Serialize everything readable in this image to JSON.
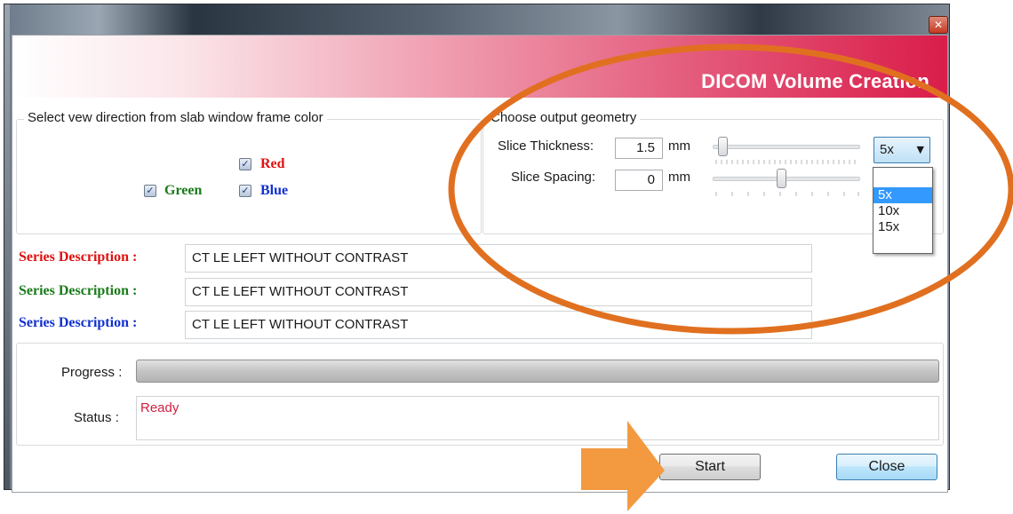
{
  "window": {
    "close_glyph": "✕",
    "header_title": "DICOM Volume Creation"
  },
  "view_direction": {
    "legend": "Select vew direction from slab window frame color",
    "checkboxes": [
      {
        "label": "Red",
        "checked": true,
        "color": "#e01010"
      },
      {
        "label": "Green",
        "checked": true,
        "color": "#1a7a1a"
      },
      {
        "label": "Blue",
        "checked": true,
        "color": "#1030d0"
      }
    ],
    "check_glyph": "✓"
  },
  "geometry": {
    "legend": "Choose output geometry",
    "slice_thickness": {
      "label": "Slice Thickness:",
      "value": "1.5",
      "unit": "mm"
    },
    "slice_spacing": {
      "label": "Slice Spacing:",
      "value": "0",
      "unit": "mm"
    },
    "multiplier": {
      "selected": "5x",
      "arrow": "▼",
      "options": [
        "",
        "5x",
        "10x",
        "15x"
      ],
      "highlighted": "5x"
    }
  },
  "series": [
    {
      "label": "Series Description :",
      "value": "CT LE LEFT WITHOUT CONTRAST",
      "color": "#e01010"
    },
    {
      "label": "Series Description :",
      "value": "CT LE LEFT WITHOUT CONTRAST",
      "color": "#1a7a1a"
    },
    {
      "label": "Series Description :",
      "value": "CT LE LEFT WITHOUT CONTRAST",
      "color": "#1030d0"
    }
  ],
  "progress": {
    "label": "Progress :",
    "fraction": 0
  },
  "status": {
    "label": "Status :",
    "text": "Ready"
  },
  "buttons": {
    "start": "Start",
    "close": "Close"
  },
  "annotations": {
    "ellipse_color": "#e07020",
    "arrow_color": "#f39a40"
  }
}
